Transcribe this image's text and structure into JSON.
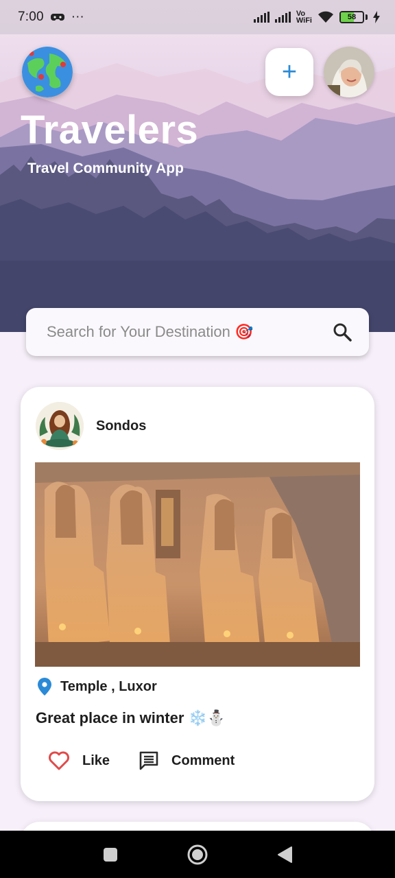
{
  "status_bar": {
    "time": "7:00",
    "dots": "···",
    "vowifi_top": "Vo",
    "vowifi_bottom": "WiFi",
    "battery": "58"
  },
  "header": {
    "title": "Travelers",
    "subtitle": "Travel Community App",
    "add_label": "+"
  },
  "search": {
    "placeholder": "Search for Your Destination 🎯"
  },
  "post": {
    "author": "Sondos",
    "location": "Temple , Luxor",
    "caption": "Great place in winter ❄️⛄",
    "like_label": "Like",
    "comment_label": "Comment"
  },
  "colors": {
    "accent": "#2a8ad6",
    "like_heart": "#e04a4a",
    "location_pin": "#2a8ad6",
    "hero_dark": "#43456b"
  }
}
